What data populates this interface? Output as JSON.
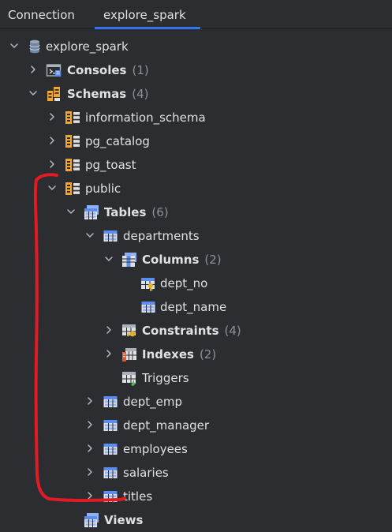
{
  "tabs": [
    {
      "label": "Connection",
      "active": false
    },
    {
      "label": "explore_spark",
      "active": true
    }
  ],
  "tree": {
    "root": {
      "label": "explore_spark",
      "icon": "database-icon",
      "expanded": true
    },
    "consoles": {
      "label": "Consoles",
      "count": "(1)",
      "icon": "console-icon",
      "expanded": false
    },
    "schemas": {
      "label": "Schemas",
      "count": "(4)",
      "icon": "schemas-icon",
      "expanded": true
    },
    "schema_items": [
      {
        "label": "information_schema",
        "icon": "schema-icon",
        "expanded": false
      },
      {
        "label": "pg_catalog",
        "icon": "schema-icon",
        "expanded": false
      },
      {
        "label": "pg_toast",
        "icon": "schema-icon",
        "expanded": false
      },
      {
        "label": "public",
        "icon": "schema-icon",
        "expanded": true
      }
    ],
    "tables": {
      "label": "Tables",
      "count": "(6)",
      "icon": "tables-icon",
      "expanded": true
    },
    "table_items": [
      {
        "label": "departments",
        "icon": "table-icon",
        "expanded": true
      },
      {
        "label": "dept_emp",
        "icon": "table-icon",
        "expanded": false
      },
      {
        "label": "dept_manager",
        "icon": "table-icon",
        "expanded": false
      },
      {
        "label": "employees",
        "icon": "table-icon",
        "expanded": false
      },
      {
        "label": "salaries",
        "icon": "table-icon",
        "expanded": false
      },
      {
        "label": "titles",
        "icon": "table-icon",
        "expanded": false
      }
    ],
    "columns": {
      "label": "Columns",
      "count": "(2)",
      "icon": "columns-icon",
      "expanded": true
    },
    "column_items": [
      {
        "label": "dept_no",
        "icon": "key-column-icon"
      },
      {
        "label": "dept_name",
        "icon": "column-icon"
      }
    ],
    "constraints": {
      "label": "Constraints",
      "count": "(4)",
      "icon": "constraints-icon",
      "expanded": false
    },
    "indexes": {
      "label": "Indexes",
      "count": "(2)",
      "icon": "indexes-icon",
      "expanded": false
    },
    "triggers": {
      "label": "Triggers",
      "icon": "triggers-icon"
    },
    "views": {
      "label": "Views",
      "icon": "views-icon"
    }
  },
  "colors": {
    "background": "#2b2d30",
    "text": "#dfe1e5",
    "count_text": "#8c9097",
    "tab_underline": "#3574f0",
    "table_icon_blue": "#5b8def",
    "schema_icon_orange": "#f0a732",
    "annotation_red": "#e01b24"
  }
}
